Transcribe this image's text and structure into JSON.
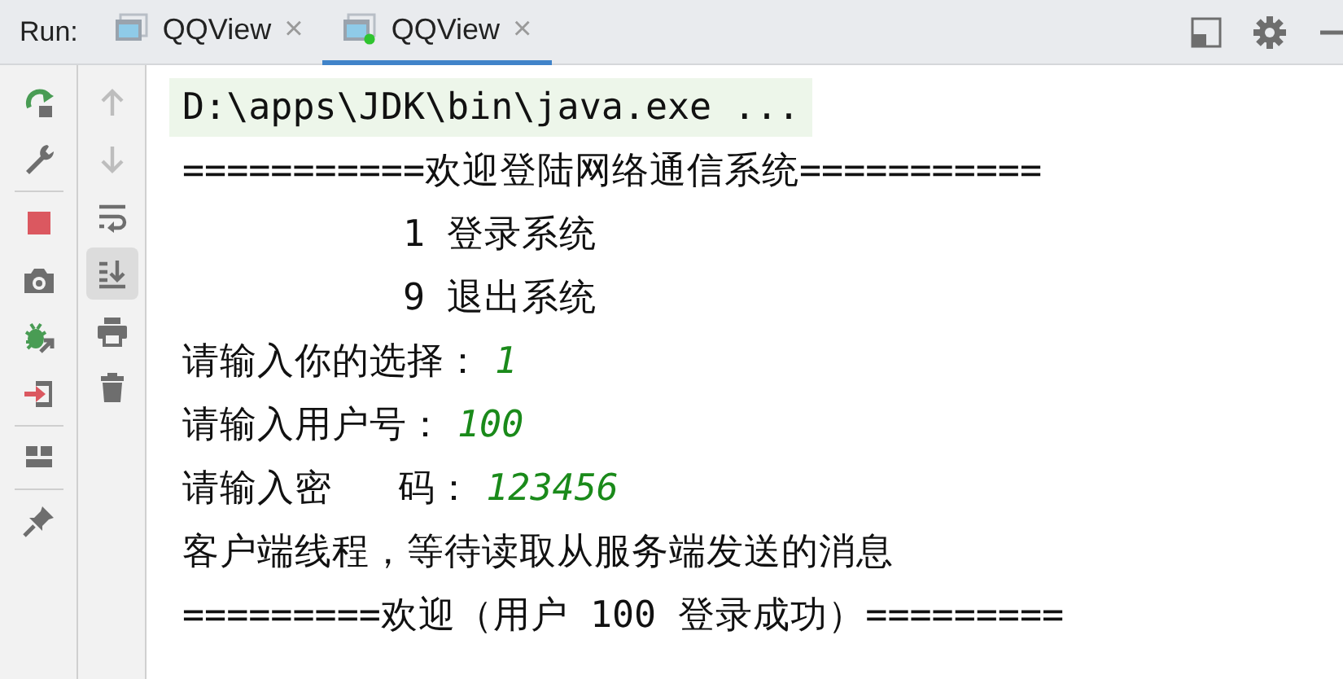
{
  "run_bar": {
    "label": "Run:",
    "tabs": [
      {
        "title": "QQView",
        "selected": false,
        "running": false,
        "close": "×"
      },
      {
        "title": "QQView",
        "selected": true,
        "running": true,
        "close": "×"
      }
    ]
  },
  "window_actions": [
    {
      "kind": "layout"
    },
    {
      "kind": "settings"
    },
    {
      "kind": "minimize"
    }
  ],
  "main_toolbar": [
    {
      "kind": "rerun"
    },
    {
      "kind": "wrench"
    },
    {
      "kind": "separator"
    },
    {
      "kind": "stop"
    },
    {
      "kind": "camera"
    },
    {
      "kind": "bug"
    },
    {
      "kind": "exit"
    },
    {
      "kind": "separator"
    },
    {
      "kind": "layout"
    },
    {
      "kind": "separator"
    },
    {
      "kind": "pin"
    }
  ],
  "console_toolbar": [
    {
      "kind": "up",
      "disabled": true,
      "selected": false
    },
    {
      "kind": "down",
      "disabled": true,
      "selected": false
    },
    {
      "kind": "wrap",
      "disabled": false,
      "selected": false
    },
    {
      "kind": "scroll-end",
      "disabled": false,
      "selected": true
    },
    {
      "kind": "print",
      "disabled": false,
      "selected": false
    },
    {
      "kind": "trash",
      "disabled": false,
      "selected": false
    }
  ],
  "console": [
    {
      "kind": "command",
      "segments": [
        {
          "kind": "output",
          "text": "D:\\apps\\JDK\\bin\\java.exe ..."
        }
      ]
    },
    {
      "kind": "output",
      "segments": [
        {
          "kind": "output",
          "text": "===========欢迎登陆网络通信系统==========="
        }
      ]
    },
    {
      "kind": "output",
      "segments": [
        {
          "kind": "output",
          "text": "          1 登录系统"
        }
      ]
    },
    {
      "kind": "output",
      "segments": [
        {
          "kind": "output",
          "text": "          9 退出系统"
        }
      ]
    },
    {
      "kind": "output",
      "segments": [
        {
          "kind": "output",
          "text": "请输入你的选择："
        },
        {
          "kind": "input",
          "text": "1"
        }
      ]
    },
    {
      "kind": "output",
      "segments": [
        {
          "kind": "output",
          "text": "请输入用户号："
        },
        {
          "kind": "input",
          "text": "100"
        }
      ]
    },
    {
      "kind": "output",
      "segments": [
        {
          "kind": "output",
          "text": "请输入密   码："
        },
        {
          "kind": "input",
          "text": "123456"
        }
      ]
    },
    {
      "kind": "output",
      "segments": [
        {
          "kind": "output",
          "text": "客户端线程，等待读取从服务端发送的消息"
        }
      ]
    },
    {
      "kind": "output",
      "segments": [
        {
          "kind": "output",
          "text": "=========欢迎（用户 100 登录成功）========="
        }
      ]
    }
  ]
}
